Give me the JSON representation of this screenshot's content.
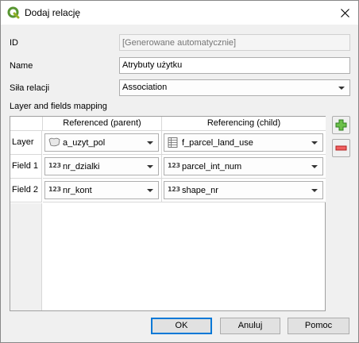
{
  "window": {
    "title": "Dodaj relację"
  },
  "form": {
    "id_label": "ID",
    "id_placeholder": "[Generowane automatycznie]",
    "name_label": "Name",
    "name_value": "Atrybuty użytku",
    "strength_label": "Siła relacji",
    "strength_value": "Association",
    "mapping_label": "Layer and fields mapping"
  },
  "mapping_table": {
    "columns": [
      "Referenced (parent)",
      "Referencing (child)"
    ],
    "rows": [
      {
        "label": "Layer",
        "parent": {
          "icon": "polygon-layer-icon",
          "text": "a_uzyt_pol"
        },
        "child": {
          "icon": "table-layer-icon",
          "text": "f_parcel_land_use"
        }
      },
      {
        "label": "Field 1",
        "parent": {
          "icon": "numeric-field-icon",
          "text": "nr_dzialki"
        },
        "child": {
          "icon": "numeric-field-icon",
          "text": "parcel_int_num"
        }
      },
      {
        "label": "Field 2",
        "parent": {
          "icon": "numeric-field-icon",
          "text": "nr_kont"
        },
        "child": {
          "icon": "numeric-field-icon",
          "text": "shape_nr"
        }
      }
    ],
    "num_icon_text": "123"
  },
  "buttons": {
    "ok": "OK",
    "cancel": "Anuluj",
    "help": "Pomoc"
  },
  "colors": {
    "accent": "#0078d7",
    "add_green": "#3a9a3a",
    "remove_red": "#d03030"
  }
}
